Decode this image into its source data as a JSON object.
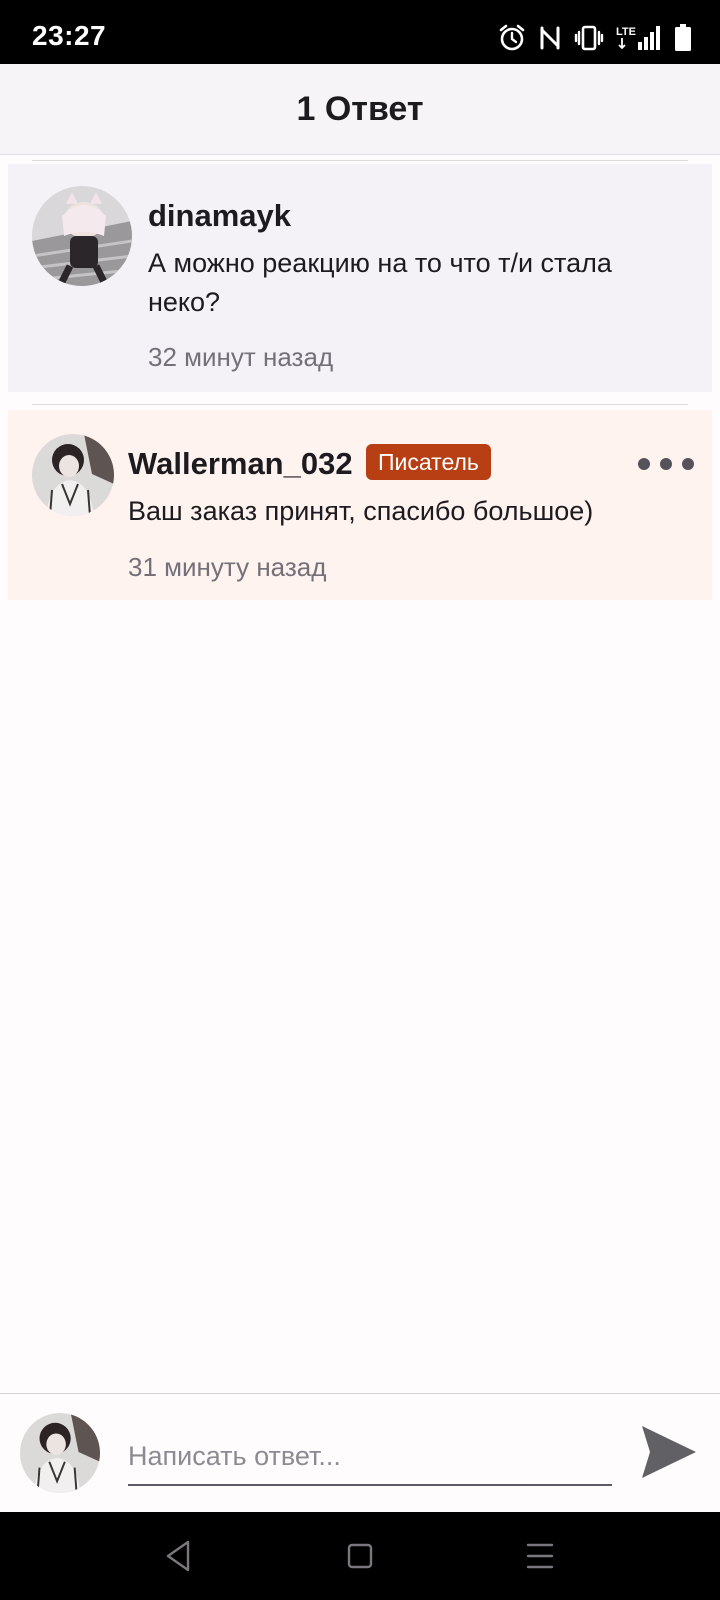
{
  "status_bar": {
    "time": "23:27",
    "icons": [
      "alarm-icon",
      "nfc-icon",
      "vibrate-icon",
      "lte-signal-icon",
      "battery-icon"
    ],
    "lte_label": "LTE"
  },
  "header": {
    "title": "1 Ответ"
  },
  "comments": [
    {
      "username": "dinamayk",
      "text": "А можно реакцию на то что т/и стала неко?",
      "time": "32 минут назад",
      "background": "#f4f2f6"
    },
    {
      "username": "Wallerman_032",
      "badge": "Писатель",
      "text": "Ваш заказ принят, спасибо большое)",
      "time": "31 минуту назад",
      "background": "#fff3f0"
    }
  ],
  "reply": {
    "placeholder": "Написать ответ...",
    "value": ""
  },
  "colors": {
    "badge": "#b83f14",
    "header_background": "#f6f4f6",
    "send_icon": "#616065"
  },
  "nav_bar": {
    "icons": [
      "back-triangle-icon",
      "home-square-icon",
      "menu-lines-icon"
    ]
  }
}
